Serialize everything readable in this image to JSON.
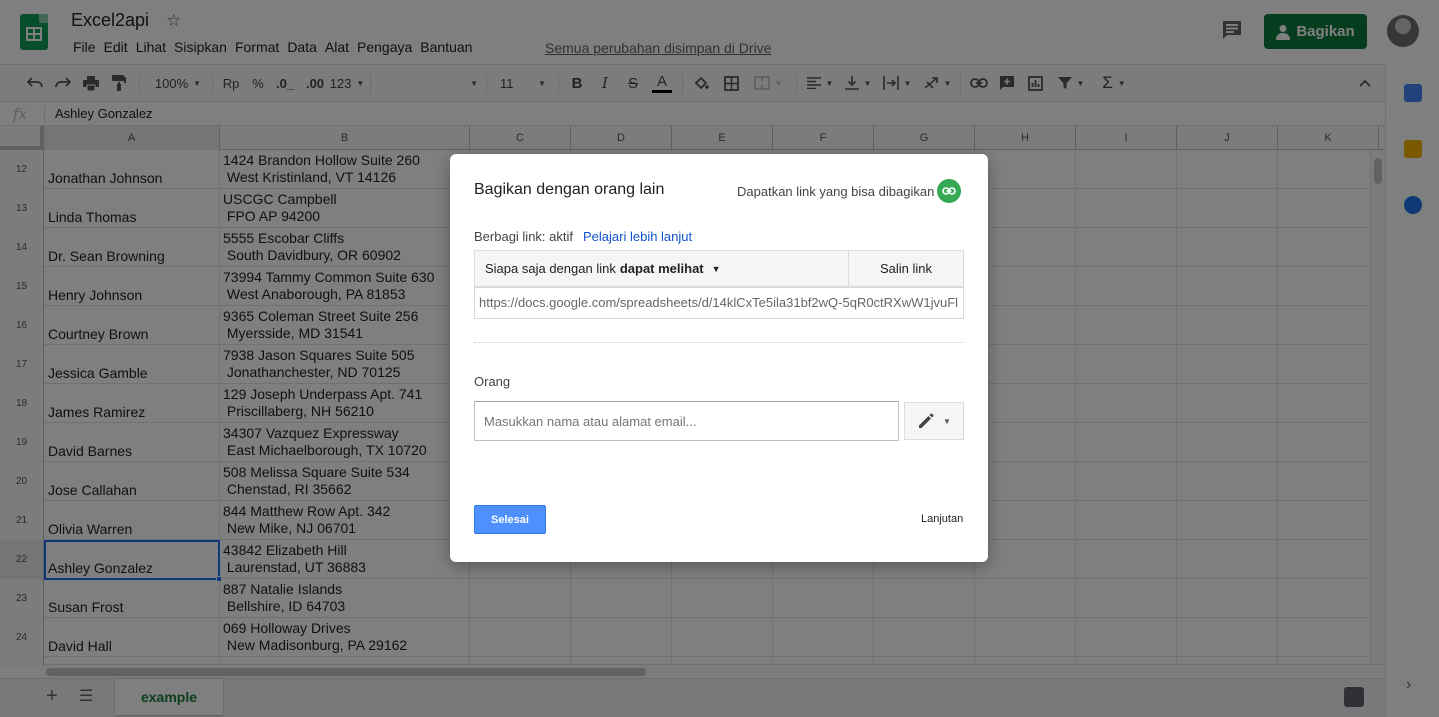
{
  "header": {
    "doc_title": "Excel2api",
    "menu": [
      "File",
      "Edit",
      "Lihat",
      "Sisipkan",
      "Format",
      "Data",
      "Alat",
      "Pengaya",
      "Bantuan"
    ],
    "saved_status": "Semua perubahan disimpan di Drive",
    "share_label": "Bagikan"
  },
  "toolbar": {
    "zoom": "100%",
    "currency": "Rp",
    "percent": "%",
    "decrease_decimal": ".0_",
    "increase_decimal": ".00",
    "more_formats": "123",
    "font_size": "11",
    "bold": "B",
    "italic": "I",
    "strike": "S",
    "text_color": "A",
    "sum": "Σ"
  },
  "formula_bar": {
    "fx": "fx",
    "value": "Ashley Gonzalez"
  },
  "grid": {
    "columns": [
      "A",
      "B",
      "C",
      "D",
      "E",
      "F",
      "G",
      "H",
      "I",
      "J",
      "K"
    ],
    "rows": [
      {
        "num": "12",
        "a": "Jonathan Johnson",
        "b": "1424 Brandon Hollow Suite 260\n West Kristinland, VT 14126"
      },
      {
        "num": "13",
        "a": "Linda Thomas",
        "b": "USCGC Campbell\n FPO AP 94200"
      },
      {
        "num": "14",
        "a": "Dr. Sean Browning",
        "b": "5555 Escobar Cliffs\n South Davidbury, OR 60902"
      },
      {
        "num": "15",
        "a": "Henry Johnson",
        "b": "73994 Tammy Common Suite 630\n West Anaborough, PA 81853"
      },
      {
        "num": "16",
        "a": "Courtney Brown",
        "b": "9365 Coleman Street Suite 256\n Myersside, MD 31541"
      },
      {
        "num": "17",
        "a": "Jessica Gamble",
        "b": "7938 Jason Squares Suite 505\n Jonathanchester, ND 70125"
      },
      {
        "num": "18",
        "a": "James Ramirez",
        "b": "129 Joseph Underpass Apt. 741\n Priscillaberg, NH 56210"
      },
      {
        "num": "19",
        "a": "David Barnes",
        "b": "34307 Vazquez Expressway\n East Michaelborough, TX 10720"
      },
      {
        "num": "20",
        "a": "Jose Callahan",
        "b": "508 Melissa Square Suite 534\n Chenstad, RI 35662"
      },
      {
        "num": "21",
        "a": "Olivia Warren",
        "b": "844 Matthew Row Apt. 342\n New Mike, NJ 06701"
      },
      {
        "num": "22",
        "a": "Ashley Gonzalez",
        "b": "43842 Elizabeth Hill\n Laurenstad, UT 36883"
      },
      {
        "num": "23",
        "a": "Susan Frost",
        "b": "887 Natalie Islands\n Bellshire, ID 64703"
      },
      {
        "num": "24",
        "a": "David Hall",
        "b": "069 Holloway Drives\n New Madisonburg, PA 29162"
      }
    ],
    "selected_row": "22"
  },
  "sheets": {
    "active_tab": "example"
  },
  "dialog": {
    "title": "Bagikan dengan orang lain",
    "get_link": "Dapatkan link yang bisa dibagikan",
    "share_status": "Berbagi link: aktif",
    "learn_more": "Pelajari lebih lanjut",
    "access_prefix": "Siapa saja dengan link",
    "access_level": "dapat melihat",
    "copy_link": "Salin link",
    "link_url": "https://docs.google.com/spreadsheets/d/14klCxTe5ila31bf2wQ-5qR0ctRXwW1jvuFl",
    "people_label": "Orang",
    "people_placeholder": "Masukkan nama atau alamat email...",
    "done": "Selesai",
    "advanced": "Lanjutan"
  },
  "colors": {
    "brand_green": "#0f9d58",
    "share_button": "#0f7a3f",
    "selection_blue": "#1a73e8",
    "done_button": "#4d90fe",
    "link_blue": "#1155cc"
  }
}
